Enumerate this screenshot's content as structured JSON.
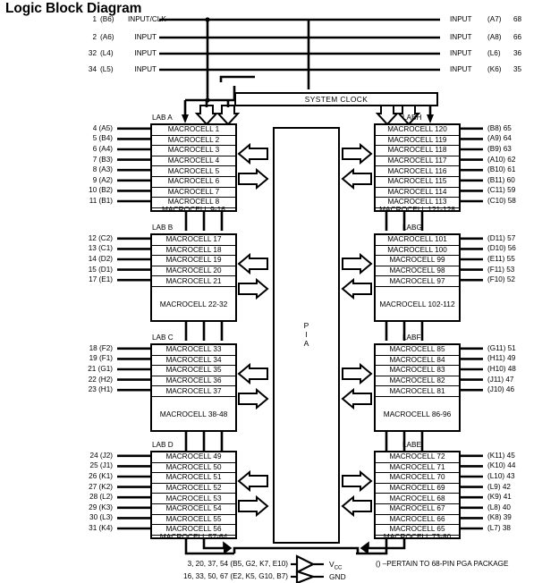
{
  "title": "Logic Block Diagram",
  "top_inputs_left": [
    {
      "pin": "1",
      "pkg": "(B6)",
      "label": "INPUT/CLK"
    },
    {
      "pin": "2",
      "pkg": "(A6)",
      "label": "INPUT"
    },
    {
      "pin": "32",
      "pkg": "(L4)",
      "label": "INPUT"
    },
    {
      "pin": "34",
      "pkg": "(L5)",
      "label": "INPUT"
    }
  ],
  "top_inputs_right": [
    {
      "label": "INPUT",
      "pkg": "(A7)",
      "pin": "68"
    },
    {
      "label": "INPUT",
      "pkg": "(A8)",
      "pin": "66"
    },
    {
      "label": "INPUT",
      "pkg": "(L6)",
      "pin": "36"
    },
    {
      "label": "INPUT",
      "pkg": "(K6)",
      "pin": "35"
    }
  ],
  "system_clock": "SYSTEM  CLOCK",
  "pia": {
    "l1": "P",
    "l2": "I",
    "l3": "A"
  },
  "labs_left": [
    {
      "name": "LAB A",
      "pins": [
        "4 (A5)",
        "5 (B4)",
        "6 (A4)",
        "7 (B3)",
        "8 (A3)",
        "9 (A2)",
        "10 (B2)",
        "11 (B1)"
      ],
      "cells": [
        "MACROCELL 1",
        "MACROCELL 2",
        "MACROCELL 3",
        "MACROCELL 4",
        "MACROCELL 5",
        "MACROCELL 6",
        "MACROCELL 7",
        "MACROCELL 8"
      ],
      "block": "MACROCELL 9-16"
    },
    {
      "name": "LAB B",
      "pins": [
        "12 (C2)",
        "13 (C1)",
        "14 (D2)",
        "15 (D1)",
        "17 (E1)"
      ],
      "cells": [
        "MACROCELL 17",
        "MACROCELL 18",
        "MACROCELL 19",
        "MACROCELL 20",
        "MACROCELL 21"
      ],
      "block": "MACROCELL 22-32"
    },
    {
      "name": "LAB C",
      "pins": [
        "18 (F2)",
        "19 (F1)",
        "21 (G1)",
        "22 (H2)",
        "23 (H1)"
      ],
      "cells": [
        "MACROCELL 33",
        "MACROCELL 34",
        "MACROCELL 35",
        "MACROCELL 36",
        "MACROCELL 37"
      ],
      "block": "MACROCELL 38-48"
    },
    {
      "name": "LAB D",
      "pins": [
        "24 (J2)",
        "25 (J1)",
        "26 (K1)",
        "27 (K2)",
        "28 (L2)",
        "29 (K3)",
        "30 (L3)",
        "31 (K4)"
      ],
      "cells": [
        "MACROCELL 49",
        "MACROCELL 50",
        "MACROCELL 51",
        "MACROCELL 52",
        "MACROCELL 53",
        "MACROCELL 54",
        "MACROCELL 55",
        "MACROCELL 56"
      ],
      "block": "MACROCELL 57-64"
    }
  ],
  "labs_right": [
    {
      "name": "LABH",
      "pins": [
        "(B8) 65",
        "(A9) 64",
        "(B9) 63",
        "(A10) 62",
        "(B10) 61",
        "(B11) 60",
        "(C11) 59",
        "(C10) 58"
      ],
      "cells": [
        "MACROCELL 120",
        "MACROCELL 119",
        "MACROCELL 118",
        "MACROCELL 117",
        "MACROCELL 116",
        "MACROCELL 115",
        "MACROCELL 114",
        "MACROCELL 113"
      ],
      "block": "MACROCELL 121-128"
    },
    {
      "name": "LABG",
      "pins": [
        "(D11) 57",
        "(D10) 56",
        "(E11) 55",
        "(F11) 53",
        "(F10) 52"
      ],
      "cells": [
        "MACROCELL 101",
        "MACROCELL 100",
        "MACROCELL 99",
        "MACROCELL 98",
        "MACROCELL 97"
      ],
      "block": "MACROCELL 102-112"
    },
    {
      "name": "LABF",
      "pins": [
        "(G11) 51",
        "(H11) 49",
        "(H10) 48",
        "(J11) 47",
        "(J10) 46"
      ],
      "cells": [
        "MACROCELL 85",
        "MACROCELL 84",
        "MACROCELL 83",
        "MACROCELL 82",
        "MACROCELL 81"
      ],
      "block": "MACROCELL 86-96"
    },
    {
      "name": "LABE",
      "pins": [
        "(K11) 45",
        "(K10) 44",
        "(L10) 43",
        "(L9) 42",
        "(K9) 41",
        "(L8) 40",
        "(K8) 39",
        "(L7) 38"
      ],
      "cells": [
        "MACROCELL 72",
        "MACROCELL 71",
        "MACROCELL 70",
        "MACROCELL 69",
        "MACROCELL 68",
        "MACROCELL 67",
        "MACROCELL 66",
        "MACROCELL 65"
      ],
      "block": "MACROCELL 73-80"
    }
  ],
  "supplies": [
    {
      "pins": "3, 20, 37, 54 (B5, G2, K7, E10)",
      "rail": "V",
      "rail_sub": "CC"
    },
    {
      "pins": "16, 33, 50, 67 (E2, K5, G10, B7)",
      "rail": "GND",
      "rail_sub": ""
    }
  ],
  "pga_note": "() –PERTAIN TO 68-PIN PGA PACKAGE"
}
